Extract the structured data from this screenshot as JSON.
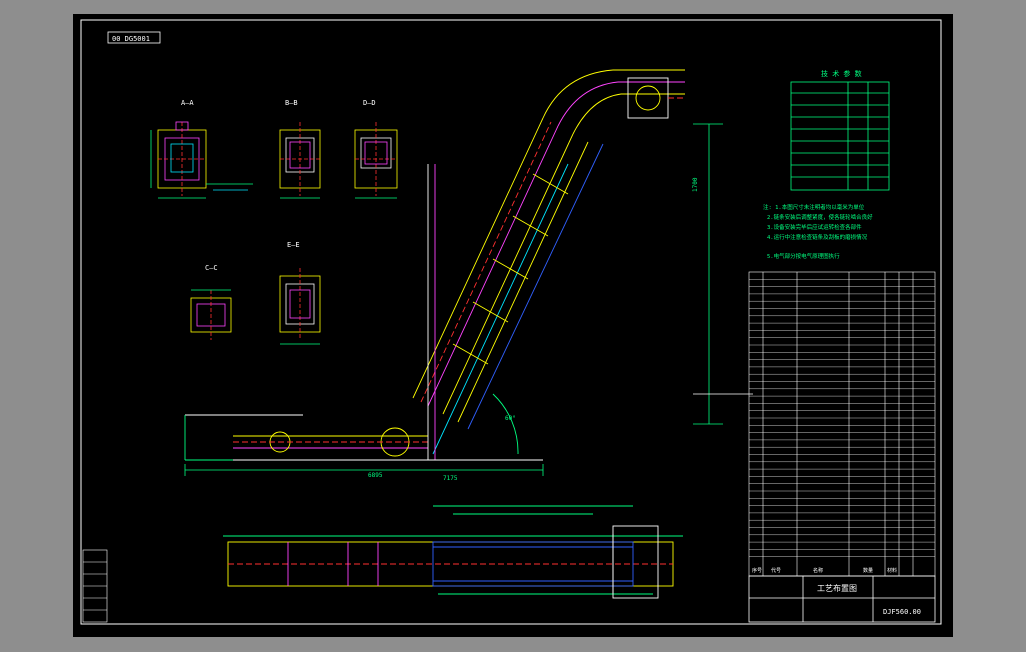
{
  "drawing": {
    "code_box": "00 DG5001",
    "drawing_no": "DJF560.00",
    "title_block_name": "工艺布置图",
    "tech_table_title": "技 术 参 数",
    "tech_rows": 9,
    "notes": [
      "注: 1.本图尺寸未注明者均以毫米为单位",
      "2.链条安装后调整紧度，使各链轮啮合良好",
      "3.设备安装完毕后应试运转检查各部件",
      "4.运行中注意检查链条及刮板的磨损情况",
      "5.电气部分按电气原理图执行"
    ],
    "parts_header": [
      "序号",
      "代号",
      "名称",
      "数量",
      "材料"
    ],
    "section_labels": [
      "A—A",
      "B—B",
      "D—D",
      "C—C",
      "E—E"
    ],
    "dims": {
      "horizontal_total": "7175",
      "base_len": "6895",
      "vertical": "1700",
      "angle": "60°"
    },
    "layer_colors": {
      "frame": "#ffffff",
      "body": "#ffff00",
      "center": "#ff3030",
      "hidden": "#ff44ff",
      "dim": "#00ff80",
      "cyan": "#00e5ff",
      "blue": "#3060ff"
    }
  }
}
